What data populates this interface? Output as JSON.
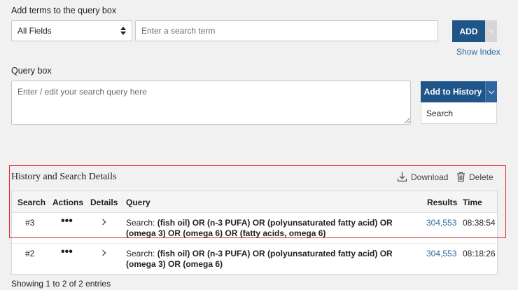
{
  "terms": {
    "label": "Add terms to the query box",
    "field_select": "All Fields",
    "term_placeholder": "Enter a search term",
    "add_label": "ADD",
    "show_index": "Show Index"
  },
  "query": {
    "label": "Query box",
    "placeholder": "Enter / edit your search query here",
    "add_to_history": "Add to History",
    "dropdown_item": "Search"
  },
  "history": {
    "title": "History and Search Details",
    "download": "Download",
    "delete": "Delete",
    "columns": [
      "Search",
      "Actions",
      "Details",
      "Query",
      "Results",
      "Time"
    ],
    "rows": [
      {
        "search": "#3",
        "actions": "•••",
        "query_prefix": "Search: ",
        "query_line1": "(fish oil) OR (n-3 PUFA) OR (polyunsaturated fatty acid) OR",
        "query_line2": "(omega 3) OR (omega 6) OR (fatty acids, omega 6)",
        "results": "304,553",
        "time": "08:38:54"
      },
      {
        "search": "#2",
        "actions": "•••",
        "query_prefix": "Search: ",
        "query_line1": "(fish oil) OR (n-3 PUFA) OR (polyunsaturated fatty acid) OR",
        "query_line2": "(omega 3) OR (omega 6)",
        "results": "304,553",
        "time": "08:18:26"
      }
    ],
    "footer": "Showing 1 to 2 of 2 entries"
  },
  "colors": {
    "primary": "#20558a",
    "link": "#2c6ca5",
    "highlight": "#e1262c"
  }
}
